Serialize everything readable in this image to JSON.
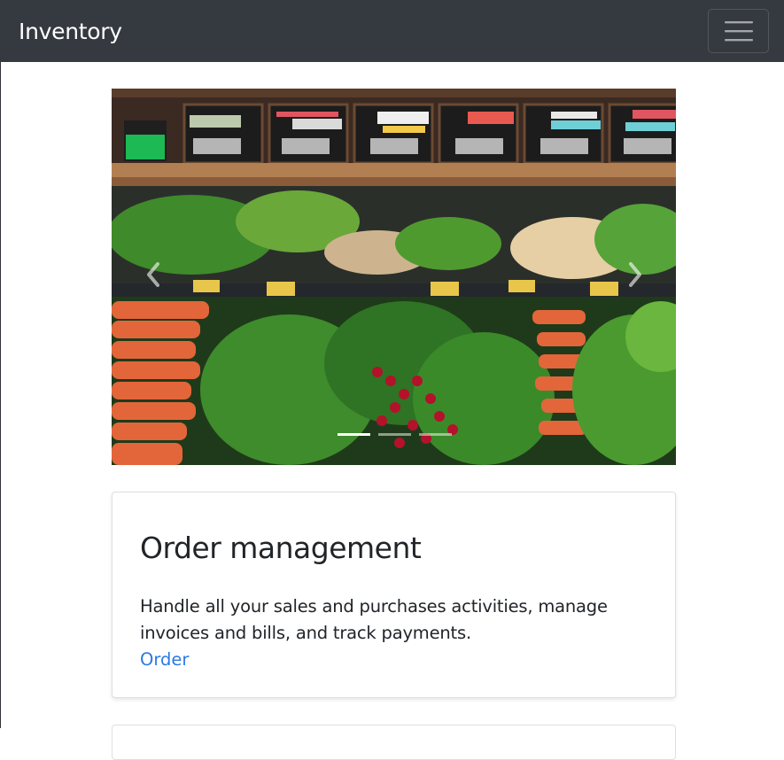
{
  "navbar": {
    "brand": "Inventory",
    "toggler_icon": "hamburger-icon",
    "background": "#343a40"
  },
  "carousel": {
    "image": "produce-aisle-photo",
    "signs": [
      {
        "name": "CILANTRO",
        "price": "2 for $1"
      },
      {
        "name": "RED RADISHES",
        "price": "2 for $1"
      },
      {
        "name": "SPINACH BUNCHES",
        "price": "$1.29 ea"
      },
      {
        "name": "CARROTS",
        "price": "77¢ ea"
      },
      {
        "name": "ROMAINE LETTUCE",
        "price": "$1.29 ea"
      },
      {
        "name": "RED LEAF LETTUCE",
        "price": "$1.29 ea"
      }
    ],
    "prev_icon": "chevron-left-icon",
    "next_icon": "chevron-right-icon",
    "indicators": [
      {
        "active": true
      },
      {
        "active": false
      },
      {
        "active": false
      }
    ]
  },
  "card": {
    "title": "Order management",
    "text": "Handle all your sales and purchases activities, manage invoices and bills, and track payments.",
    "link": "Order",
    "link_color": "#2a7ae2"
  }
}
